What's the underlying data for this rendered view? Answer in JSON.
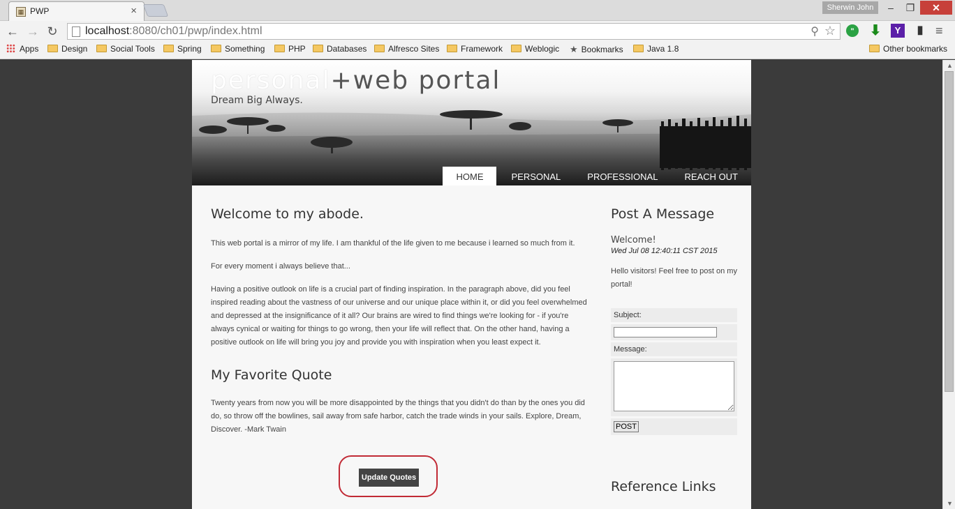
{
  "browser": {
    "tab_title": "PWP",
    "tab_favicon_glyph": "▦",
    "close_glyph": "×",
    "user": "Sherwin John",
    "window": {
      "minimize": "–",
      "maximize": "❐",
      "close": "✕"
    },
    "nav": {
      "back": "←",
      "forward": "→",
      "reload": "↻"
    },
    "url_host": "localhost",
    "url_path": ":8080/ch01/pwp/index.html",
    "zoom_glyph": "⚲",
    "star_glyph": "☆",
    "extensions": {
      "hangouts": "\"",
      "download": "⬇",
      "yahoo": "Y",
      "reader": "▮"
    },
    "menu_glyph": "≡",
    "bookmarks": [
      "Apps",
      "Design",
      "Social Tools",
      "Spring",
      "Something",
      "PHP",
      "Databases",
      "Alfresco Sites",
      "Framework",
      "Weblogic",
      "Bookmarks",
      "Java 1.8"
    ],
    "other_bookmarks": "Other bookmarks",
    "scroll": {
      "up": "▲",
      "down": "▼"
    }
  },
  "site": {
    "title_part1": "personal",
    "title_part2": "+web portal",
    "tagline": "Dream Big Always.",
    "nav": [
      "HOME",
      "PERSONAL",
      "PROFESSIONAL",
      "REACH OUT"
    ],
    "active_nav": "HOME"
  },
  "main": {
    "heading": "Welcome to my abode.",
    "p1": "This web portal is a mirror of my life. I am thankful of the life given to me because i learned so much from it.",
    "p2": "For every moment i always believe that...",
    "p3": "Having a positive outlook on life is a crucial part of finding inspiration. In the paragraph above, did you feel inspired reading about the vastness of our universe and our unique place within it, or did you feel overwhelmed and depressed at the insignificance of it all? Our brains are wired to find things we're looking for - if you're always cynical or waiting for things to go wrong, then your life will reflect that. On the other hand, having a positive outlook on life will bring you joy and provide you with inspiration when you least expect it.",
    "quote_heading": "My Favorite Quote",
    "quote": "Twenty years from now you will be more disappointed by the things that you didn't do than by the ones you did do, so throw off the bowlines, sail away from safe harbor, catch the trade winds in your sails. Explore, Dream, Discover. -Mark Twain",
    "update_button": "Update Quotes"
  },
  "sidebar": {
    "heading": "Post A Message",
    "welcome": "Welcome!",
    "date": "Wed Jul 08 12:40:11 CST 2015",
    "hello": "Hello visitors! Feel free to post on my portal!",
    "subject_label": "Subject:",
    "subject_value": "",
    "message_label": "Message:",
    "message_value": "",
    "post_button": "POST",
    "ref_heading": "Reference Links"
  },
  "colors": {
    "highlight_ring": "#c12a35",
    "nav_active_bg": "#ffffff",
    "button_bg": "#444444"
  }
}
